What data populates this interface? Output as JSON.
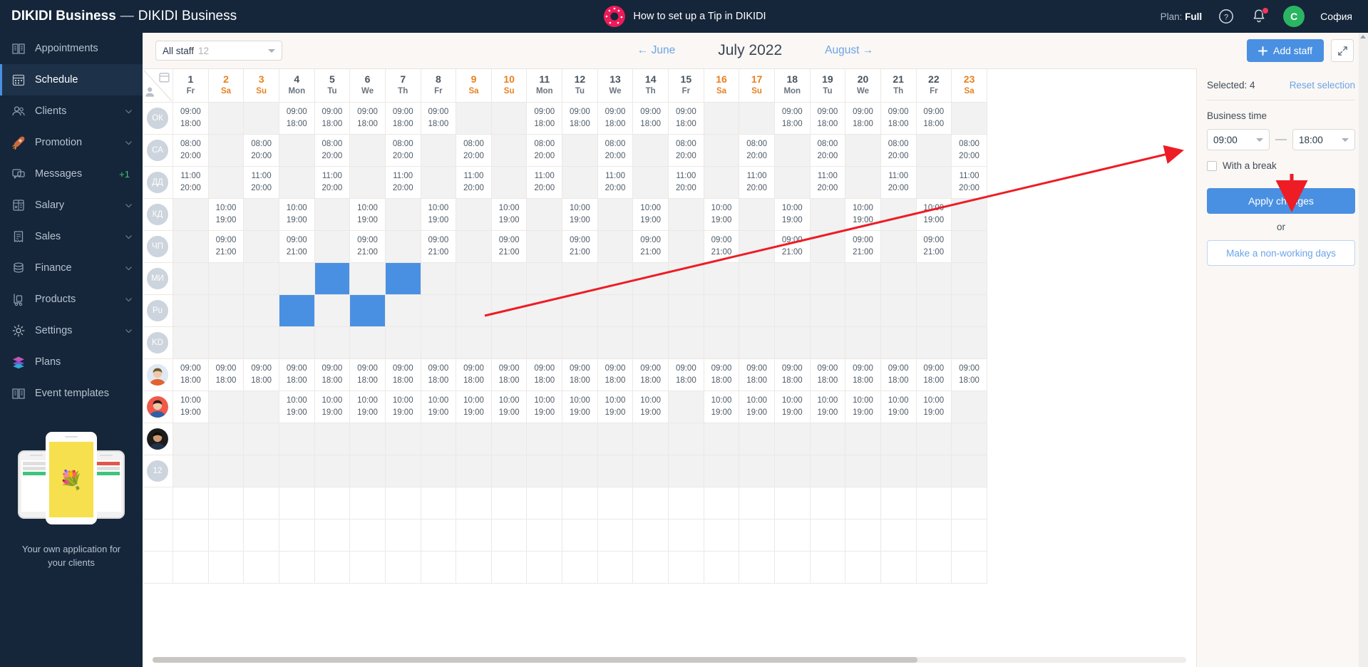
{
  "app": {
    "brand_primary": "DIKIDI Business",
    "brand_dash": "—",
    "brand_secondary": "DIKIDI Business",
    "tip_link": "How to set up a Tip in DIKIDI",
    "plan_label": "Plan:",
    "plan_value": "Full",
    "avatar_initial": "C",
    "user_name": "София",
    "accent_blue": "#4a90e2",
    "sidebar_bg": "#15263a",
    "weekend_color": "#e8801f",
    "selected_cell_color": "#4a90e2"
  },
  "sidebar": {
    "items": [
      {
        "label": "Appointments",
        "icon": "book-icon",
        "active": false,
        "chevron": false,
        "badge": ""
      },
      {
        "label": "Schedule",
        "icon": "calendar-icon",
        "active": true,
        "chevron": false,
        "badge": ""
      },
      {
        "label": "Clients",
        "icon": "users-icon",
        "active": false,
        "chevron": true,
        "badge": ""
      },
      {
        "label": "Promotion",
        "icon": "rocket-icon",
        "active": false,
        "chevron": true,
        "badge": ""
      },
      {
        "label": "Messages",
        "icon": "chat-icon",
        "active": false,
        "chevron": false,
        "badge": "+1"
      },
      {
        "label": "Salary",
        "icon": "calculator-icon",
        "active": false,
        "chevron": true,
        "badge": ""
      },
      {
        "label": "Sales",
        "icon": "receipt-icon",
        "active": false,
        "chevron": true,
        "badge": ""
      },
      {
        "label": "Finance",
        "icon": "coins-icon",
        "active": false,
        "chevron": true,
        "badge": ""
      },
      {
        "label": "Products",
        "icon": "trolley-icon",
        "active": false,
        "chevron": true,
        "badge": ""
      },
      {
        "label": "Settings",
        "icon": "gear-icon",
        "active": false,
        "chevron": true,
        "badge": ""
      },
      {
        "label": "Plans",
        "icon": "layers-icon",
        "active": false,
        "chevron": false,
        "badge": ""
      },
      {
        "label": "Event templates",
        "icon": "book-icon",
        "active": false,
        "chevron": false,
        "badge": ""
      }
    ],
    "promo_line1": "Your own application for",
    "promo_line2": "your clients"
  },
  "toolbar": {
    "staff_filter_label": "All staff",
    "staff_filter_count": "12",
    "prev_month": "← June",
    "current_month": "July 2022",
    "next_month": "August →",
    "add_staff_label": "Add staff",
    "expand_icon": "expand-icon"
  },
  "grid": {
    "days": [
      {
        "num": "1",
        "wd": "Fr",
        "weekend": false
      },
      {
        "num": "2",
        "wd": "Sa",
        "weekend": true
      },
      {
        "num": "3",
        "wd": "Su",
        "weekend": true
      },
      {
        "num": "4",
        "wd": "Mon",
        "weekend": false
      },
      {
        "num": "5",
        "wd": "Tu",
        "weekend": false
      },
      {
        "num": "6",
        "wd": "We",
        "weekend": false
      },
      {
        "num": "7",
        "wd": "Th",
        "weekend": false
      },
      {
        "num": "8",
        "wd": "Fr",
        "weekend": false
      },
      {
        "num": "9",
        "wd": "Sa",
        "weekend": true
      },
      {
        "num": "10",
        "wd": "Su",
        "weekend": true
      },
      {
        "num": "11",
        "wd": "Mon",
        "weekend": false
      },
      {
        "num": "12",
        "wd": "Tu",
        "weekend": false
      },
      {
        "num": "13",
        "wd": "We",
        "weekend": false
      },
      {
        "num": "14",
        "wd": "Th",
        "weekend": false
      },
      {
        "num": "15",
        "wd": "Fr",
        "weekend": false
      },
      {
        "num": "16",
        "wd": "Sa",
        "weekend": true
      },
      {
        "num": "17",
        "wd": "Su",
        "weekend": true
      },
      {
        "num": "18",
        "wd": "Mon",
        "weekend": false
      },
      {
        "num": "19",
        "wd": "Tu",
        "weekend": false
      },
      {
        "num": "20",
        "wd": "We",
        "weekend": false
      },
      {
        "num": "21",
        "wd": "Th",
        "weekend": false
      },
      {
        "num": "22",
        "wd": "Fr",
        "weekend": false
      },
      {
        "num": "23",
        "wd": "Sa",
        "weekend": true
      }
    ],
    "rows": [
      {
        "initials": "ОК",
        "photo": false,
        "cells": [
          "09:00|18:00",
          "",
          "",
          "09:00|18:00",
          "09:00|18:00",
          "09:00|18:00",
          "09:00|18:00",
          "09:00|18:00",
          "",
          "",
          "09:00|18:00",
          "09:00|18:00",
          "09:00|18:00",
          "09:00|18:00",
          "09:00|18:00",
          "",
          "",
          "09:00|18:00",
          "09:00|18:00",
          "09:00|18:00",
          "09:00|18:00",
          "09:00|18:00",
          ""
        ]
      },
      {
        "initials": "СА",
        "photo": false,
        "cells": [
          "08:00|20:00",
          "",
          "08:00|20:00",
          "",
          "08:00|20:00",
          "",
          "08:00|20:00",
          "",
          "08:00|20:00",
          "",
          "08:00|20:00",
          "",
          "08:00|20:00",
          "",
          "08:00|20:00",
          "",
          "08:00|20:00",
          "",
          "08:00|20:00",
          "",
          "08:00|20:00",
          "",
          "08:00|20:00"
        ]
      },
      {
        "initials": "ДД",
        "photo": false,
        "cells": [
          "11:00|20:00",
          "",
          "11:00|20:00",
          "",
          "11:00|20:00",
          "",
          "11:00|20:00",
          "",
          "11:00|20:00",
          "",
          "11:00|20:00",
          "",
          "11:00|20:00",
          "",
          "11:00|20:00",
          "",
          "11:00|20:00",
          "",
          "11:00|20:00",
          "",
          "11:00|20:00",
          "",
          "11:00|20:00"
        ]
      },
      {
        "initials": "КД",
        "photo": false,
        "cells": [
          "",
          "10:00|19:00",
          "",
          "10:00|19:00",
          "",
          "10:00|19:00",
          "",
          "10:00|19:00",
          "",
          "10:00|19:00",
          "",
          "10:00|19:00",
          "",
          "10:00|19:00",
          "",
          "10:00|19:00",
          "",
          "10:00|19:00",
          "",
          "10:00|19:00",
          "",
          "10:00|19:00",
          ""
        ]
      },
      {
        "initials": "ЧП",
        "photo": false,
        "cells": [
          "",
          "09:00|21:00",
          "",
          "09:00|21:00",
          "",
          "09:00|21:00",
          "",
          "09:00|21:00",
          "",
          "09:00|21:00",
          "",
          "09:00|21:00",
          "",
          "09:00|21:00",
          "",
          "09:00|21:00",
          "",
          "09:00|21:00",
          "",
          "09:00|21:00",
          "",
          "09:00|21:00",
          ""
        ]
      },
      {
        "initials": "МИ",
        "photo": false,
        "selected": [
          5,
          7
        ],
        "cells": [
          "",
          "",
          "",
          "",
          "",
          "",
          "",
          "",
          "",
          "",
          "",
          "",
          "",
          "",
          "",
          "",
          "",
          "",
          "",
          "",
          "",
          "",
          ""
        ]
      },
      {
        "initials": "Pu",
        "photo": false,
        "selected": [
          4,
          6
        ],
        "cells": [
          "",
          "",
          "",
          "",
          "",
          "",
          "",
          "",
          "",
          "",
          "",
          "",
          "",
          "",
          "",
          "",
          "",
          "",
          "",
          "",
          "",
          "",
          ""
        ]
      },
      {
        "initials": "KD",
        "photo": false,
        "cells": [
          "",
          "",
          "",
          "",
          "",
          "",
          "",
          "",
          "",
          "",
          "",
          "",
          "",
          "",
          "",
          "",
          "",
          "",
          "",
          "",
          "",
          "",
          ""
        ]
      },
      {
        "initials": "",
        "photo": true,
        "photo_kind": "man-blond",
        "cells": [
          "09:00|18:00",
          "09:00|18:00",
          "09:00|18:00",
          "09:00|18:00",
          "09:00|18:00",
          "09:00|18:00",
          "09:00|18:00",
          "09:00|18:00",
          "09:00|18:00",
          "09:00|18:00",
          "09:00|18:00",
          "09:00|18:00",
          "09:00|18:00",
          "09:00|18:00",
          "09:00|18:00",
          "09:00|18:00",
          "09:00|18:00",
          "09:00|18:00",
          "09:00|18:00",
          "09:00|18:00",
          "09:00|18:00",
          "09:00|18:00",
          "09:00|18:00"
        ]
      },
      {
        "initials": "",
        "photo": true,
        "photo_kind": "woman-red",
        "cells": [
          "10:00|19:00",
          "",
          "",
          "10:00|19:00",
          "10:00|19:00",
          "10:00|19:00",
          "10:00|19:00",
          "10:00|19:00",
          "10:00|19:00",
          "10:00|19:00",
          "10:00|19:00",
          "10:00|19:00",
          "10:00|19:00",
          "10:00|19:00",
          "",
          "10:00|19:00",
          "10:00|19:00",
          "10:00|19:00",
          "10:00|19:00",
          "10:00|19:00",
          "10:00|19:00",
          "10:00|19:00",
          ""
        ]
      },
      {
        "initials": "",
        "photo": true,
        "photo_kind": "man-dark",
        "cells": [
          "",
          "",
          "",
          "",
          "",
          "",
          "",
          "",
          "",
          "",
          "",
          "",
          "",
          "",
          "",
          "",
          "",
          "",
          "",
          "",
          "",
          "",
          ""
        ]
      },
      {
        "initials": "12",
        "photo": false,
        "cells": [
          "",
          "",
          "",
          "",
          "",
          "",
          "",
          "",
          "",
          "",
          "",
          "",
          "",
          "",
          "",
          "",
          "",
          "",
          "",
          "",
          "",
          "",
          ""
        ]
      }
    ]
  },
  "panel": {
    "selected_text": "Selected: 4",
    "reset_label": "Reset selection",
    "business_time_label": "Business time",
    "time_from": "09:00",
    "time_to": "18:00",
    "time_dash": "—",
    "break_label": "With a break",
    "apply_label": "Apply changes",
    "or_label": "or",
    "nonworking_label": "Make a non-working days"
  }
}
